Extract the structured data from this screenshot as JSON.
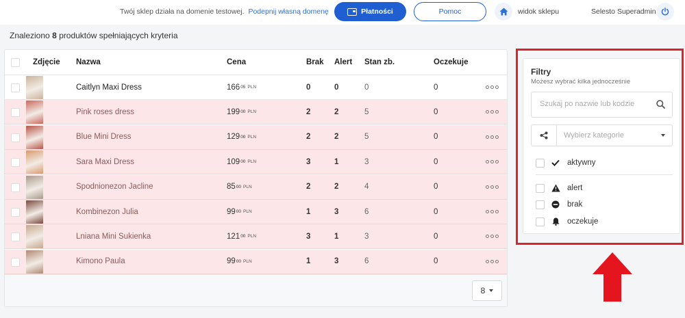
{
  "topbar": {
    "notice": "Twój sklep działa na domenie testowej.",
    "notice_link": "Podepnij własną domenę",
    "payments_button": "Płatności",
    "help_button": "Pomoc",
    "store_link": "widok sklepu",
    "user_name": "Selesto Superadmin",
    "icons": {
      "wallet": "wallet-icon",
      "home": "home-icon",
      "power": "power-icon"
    }
  },
  "results": {
    "prefix": "Znaleziono",
    "count": "8",
    "suffix": "produktów spełniających kryteria"
  },
  "table": {
    "headers": {
      "photo": "Zdjęcie",
      "name": "Nazwa",
      "price": "Cena",
      "brak": "Brak",
      "alert": "Alert",
      "stan": "Stan zb.",
      "oczekuje": "Oczekuje"
    },
    "currency": "PLN",
    "rows": [
      {
        "name": "Caitlyn Maxi Dress",
        "price_int": "166",
        "price_dec": "05",
        "brak": "0",
        "alert": "0",
        "stan": "0",
        "oczekuje": "0",
        "status": "ok",
        "photo_color": "#cbb39c"
      },
      {
        "name": "Pink roses dress",
        "price_int": "199",
        "price_dec": "00",
        "brak": "2",
        "alert": "2",
        "stan": "5",
        "oczekuje": "0",
        "status": "warn",
        "photo_color": "#c96a5e"
      },
      {
        "name": "Blue Mini Dress",
        "price_int": "129",
        "price_dec": "00",
        "brak": "2",
        "alert": "2",
        "stan": "5",
        "oczekuje": "0",
        "status": "warn",
        "photo_color": "#b85448"
      },
      {
        "name": "Sara Maxi Dress",
        "price_int": "109",
        "price_dec": "00",
        "brak": "3",
        "alert": "1",
        "stan": "3",
        "oczekuje": "0",
        "status": "warn",
        "photo_color": "#d99a6c"
      },
      {
        "name": "Spodnionezon Jacline",
        "price_int": "85",
        "price_dec": "00",
        "brak": "2",
        "alert": "2",
        "stan": "4",
        "oczekuje": "0",
        "status": "warn",
        "photo_color": "#a89a8a"
      },
      {
        "name": "Kombinezon Julia",
        "price_int": "99",
        "price_dec": "00",
        "brak": "1",
        "alert": "3",
        "stan": "6",
        "oczekuje": "0",
        "status": "warn",
        "photo_color": "#7a4a3e"
      },
      {
        "name": "Lniana Mini Sukienka",
        "price_int": "121",
        "price_dec": "00",
        "brak": "3",
        "alert": "1",
        "stan": "3",
        "oczekuje": "0",
        "status": "warn",
        "photo_color": "#c7a88e"
      },
      {
        "name": "Kimono Paula",
        "price_int": "99",
        "price_dec": "00",
        "brak": "1",
        "alert": "3",
        "stan": "6",
        "oczekuje": "0",
        "status": "warn",
        "photo_color": "#b08a74"
      }
    ],
    "per_page": "8"
  },
  "filters": {
    "title": "Filtry",
    "subtitle": "Możesz wybrać kilka jednocześnie",
    "search_placeholder": "Szukaj po nazwie lub kodzie",
    "category_placeholder": "Wybierz kategorie",
    "options": {
      "active": "aktywny",
      "alert": "alert",
      "brak": "brak",
      "oczekuje": "oczekuje"
    }
  },
  "colors": {
    "accent": "#1f5fd1",
    "row_warning": "#fde6e8",
    "highlight": "#d9232d"
  }
}
